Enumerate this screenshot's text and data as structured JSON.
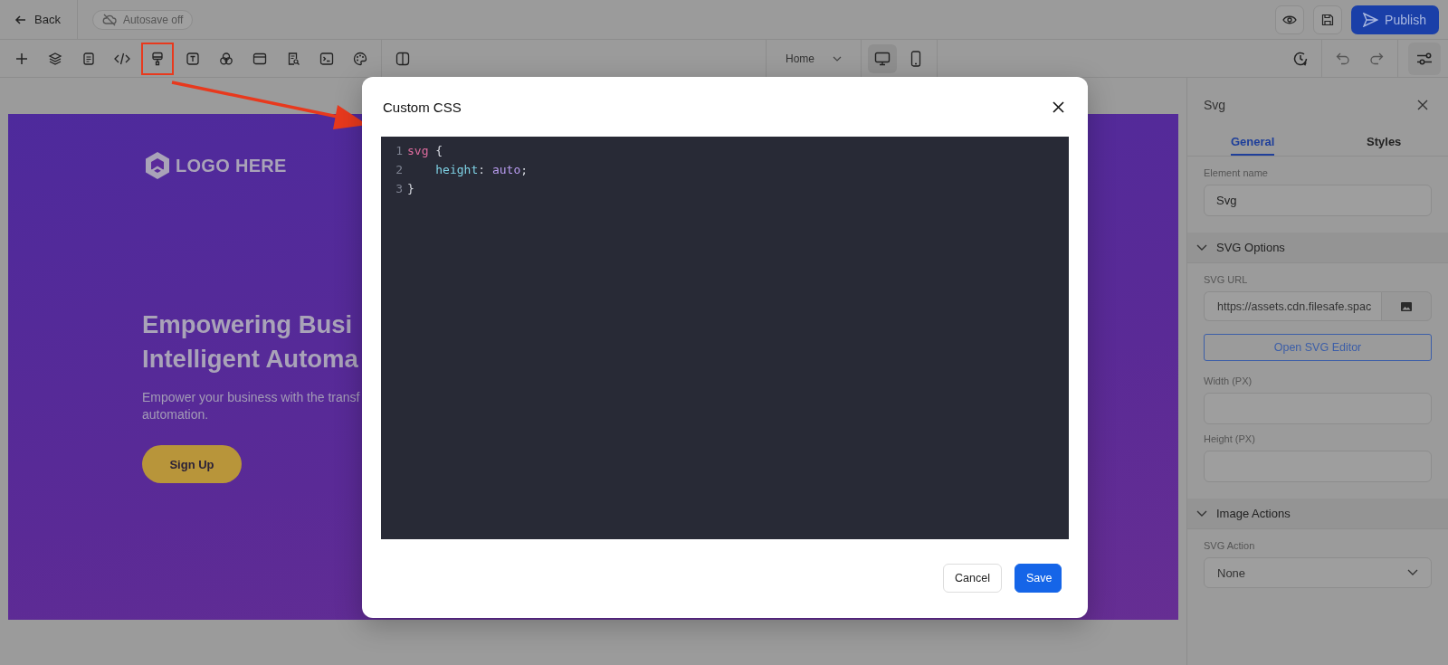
{
  "top_bar": {
    "back": "Back",
    "autosave": "Autosave off",
    "publish": "Publish"
  },
  "toolbar": {
    "tools": [
      {
        "highlighted": false
      },
      {
        "highlighted": false
      },
      {
        "highlighted": false
      },
      {
        "highlighted": false
      },
      {
        "highlighted": true
      },
      {
        "highlighted": false
      },
      {
        "highlighted": false
      },
      {
        "highlighted": false
      },
      {
        "highlighted": false
      },
      {
        "highlighted": false
      },
      {
        "highlighted": false
      }
    ],
    "page_select": "Home",
    "devices": [
      {
        "kind": "desktop",
        "selected": true
      },
      {
        "kind": "mobile",
        "selected": false
      }
    ]
  },
  "canvas": {
    "logo": "LOGO HERE",
    "heading": [
      "Empowering Busi",
      "Intelligent Automa"
    ],
    "subtext": [
      "Empower your business with the transf",
      "automation."
    ],
    "cta": "Sign Up"
  },
  "modal": {
    "title": "Custom CSS",
    "code": [
      {
        "number": "1",
        "indented": false,
        "tokens": [
          {
            "kind": "selector",
            "text": "svg"
          },
          {
            "kind": "punct",
            "text": " {"
          }
        ]
      },
      {
        "number": "2",
        "indented": true,
        "tokens": [
          {
            "kind": "property",
            "text": "height"
          },
          {
            "kind": "punct",
            "text": ": "
          },
          {
            "kind": "value",
            "text": "auto"
          },
          {
            "kind": "punct",
            "text": ";"
          }
        ]
      },
      {
        "number": "3",
        "indented": false,
        "tokens": [
          {
            "kind": "punct",
            "text": "}"
          }
        ]
      }
    ],
    "buttons": [
      {
        "kind": "secondary",
        "label": "Cancel"
      },
      {
        "kind": "primary",
        "label": "Save"
      }
    ]
  },
  "panel": {
    "title": "Svg",
    "tabs": [
      {
        "label": "General",
        "selected": true
      },
      {
        "label": "Styles",
        "selected": false
      }
    ],
    "element_name": {
      "label": "Element name",
      "value": "Svg"
    },
    "sections": [
      {
        "title": "SVG Options",
        "expanded": true,
        "fields": [
          {
            "kind": "url",
            "label": "SVG URL",
            "value": "https://assets.cdn.filesafe.spac"
          },
          {
            "kind": "button",
            "label": "Open SVG Editor"
          },
          {
            "kind": "text",
            "label": "Width (PX)"
          },
          {
            "kind": "text",
            "label": "Height (PX)"
          }
        ]
      },
      {
        "title": "Image Actions",
        "expanded": true,
        "fields": [
          {
            "kind": "select",
            "label": "SVG Action",
            "value": "None"
          }
        ]
      }
    ]
  }
}
